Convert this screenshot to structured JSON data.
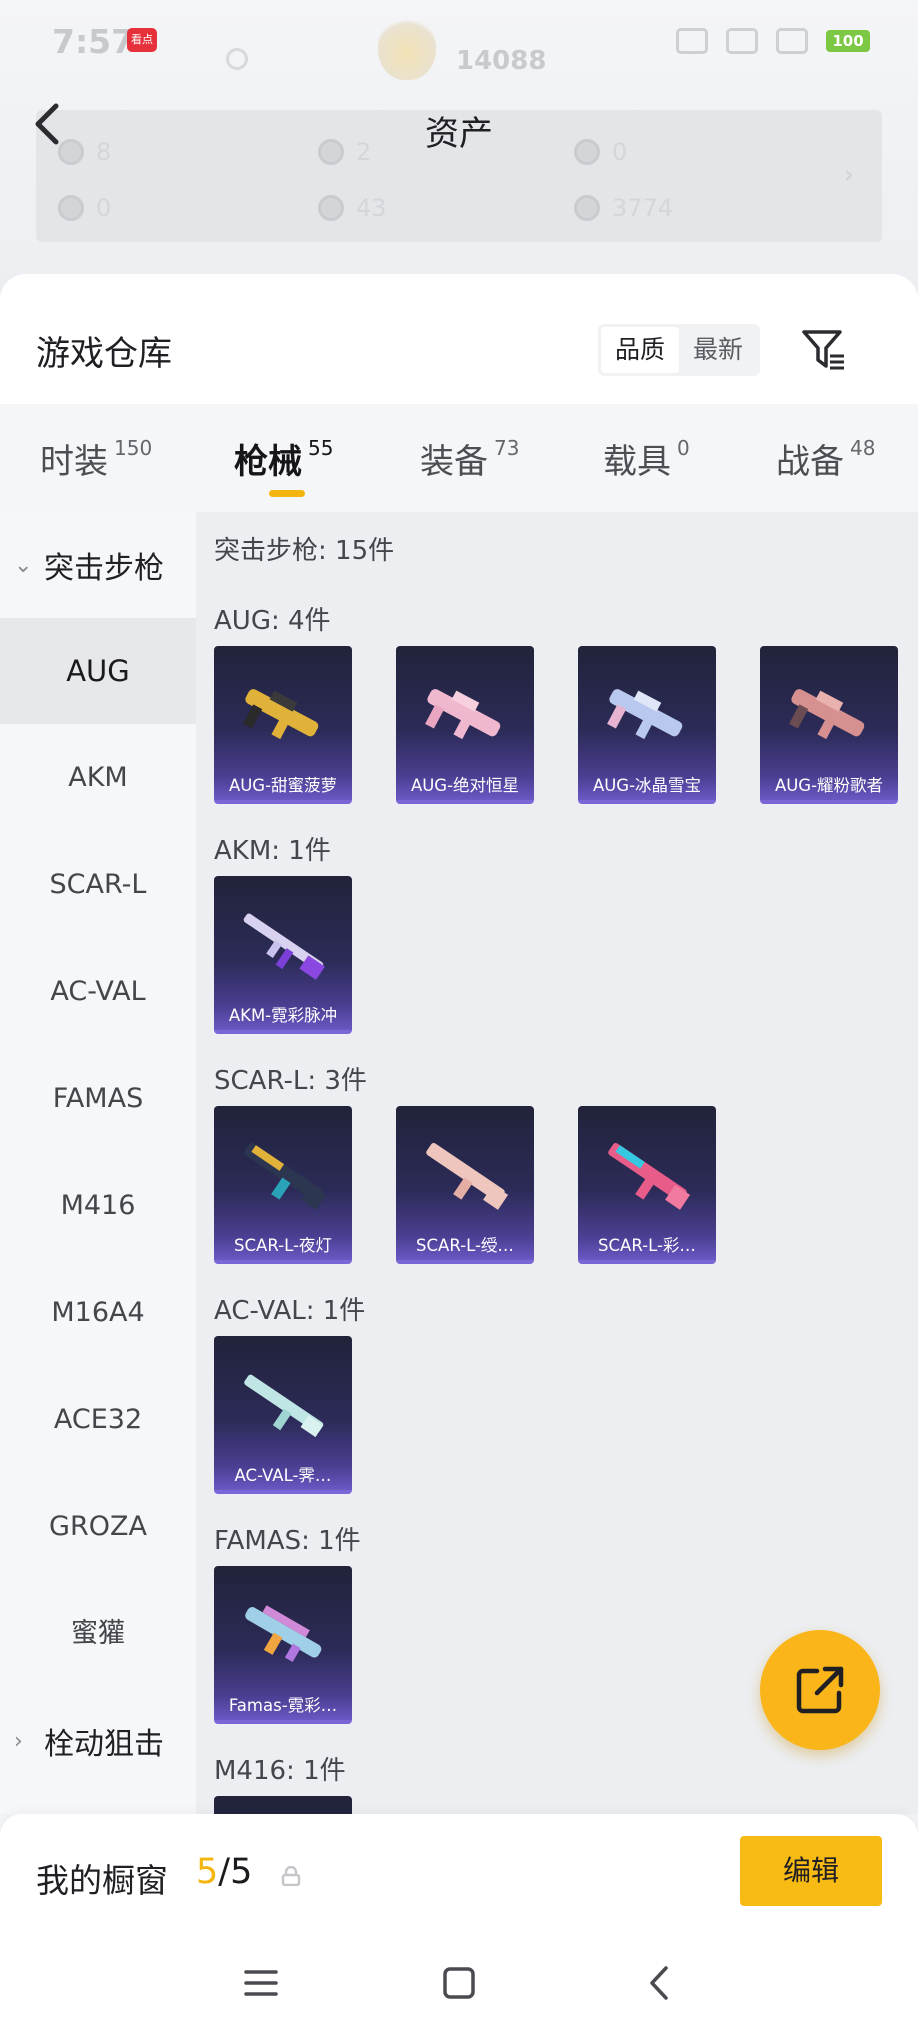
{
  "status_bar": {
    "time": "7:57",
    "app_badge": "看点",
    "score": "14088",
    "battery": "100"
  },
  "header": {
    "title": "资产"
  },
  "assets": [
    {
      "value": "8"
    },
    {
      "value": "2"
    },
    {
      "value": "0"
    },
    {
      "value": "0"
    },
    {
      "value": "43"
    },
    {
      "value": "3774"
    }
  ],
  "warehouse": {
    "title": "游戏仓库",
    "sort": {
      "quality": "品质",
      "newest": "最新"
    }
  },
  "tabs": [
    {
      "label": "时装",
      "count": "150"
    },
    {
      "label": "枪械",
      "count": "55"
    },
    {
      "label": "装备",
      "count": "73"
    },
    {
      "label": "载具",
      "count": "0"
    },
    {
      "label": "战备",
      "count": "48"
    }
  ],
  "categories": {
    "group": "突击步枪",
    "items": [
      "AUG",
      "AKM",
      "SCAR-L",
      "AC-VAL",
      "FAMAS",
      "M416",
      "M16A4",
      "ACE32",
      "GROZA",
      "蜜獾"
    ],
    "next_group": "栓动狙击"
  },
  "content": {
    "total": "突击步枪: 15件",
    "groups": [
      {
        "label": "AUG: 4件",
        "items": [
          "AUG-甜蜜菠萝",
          "AUG-绝对恒星",
          "AUG-冰晶雪宝",
          "AUG-耀粉歌者"
        ]
      },
      {
        "label": "AKM: 1件",
        "items": [
          "AKM-霓彩脉冲"
        ]
      },
      {
        "label": "SCAR-L: 3件",
        "items": [
          "SCAR-L-夜灯",
          "SCAR-L-绶…",
          "SCAR-L-彩…"
        ]
      },
      {
        "label": "AC-VAL: 1件",
        "items": [
          "AC-VAL-霁…"
        ]
      },
      {
        "label": "FAMAS: 1件",
        "items": [
          "Famas-霓彩…"
        ]
      },
      {
        "label": "M416: 1件",
        "items": []
      }
    ]
  },
  "showcase": {
    "label": "我的橱窗",
    "current": "5",
    "total": "/5",
    "edit": "编辑"
  },
  "colors": {
    "accent": "#f8bb14",
    "card_top": "#21233a",
    "card_bottom": "#6a58c4"
  }
}
